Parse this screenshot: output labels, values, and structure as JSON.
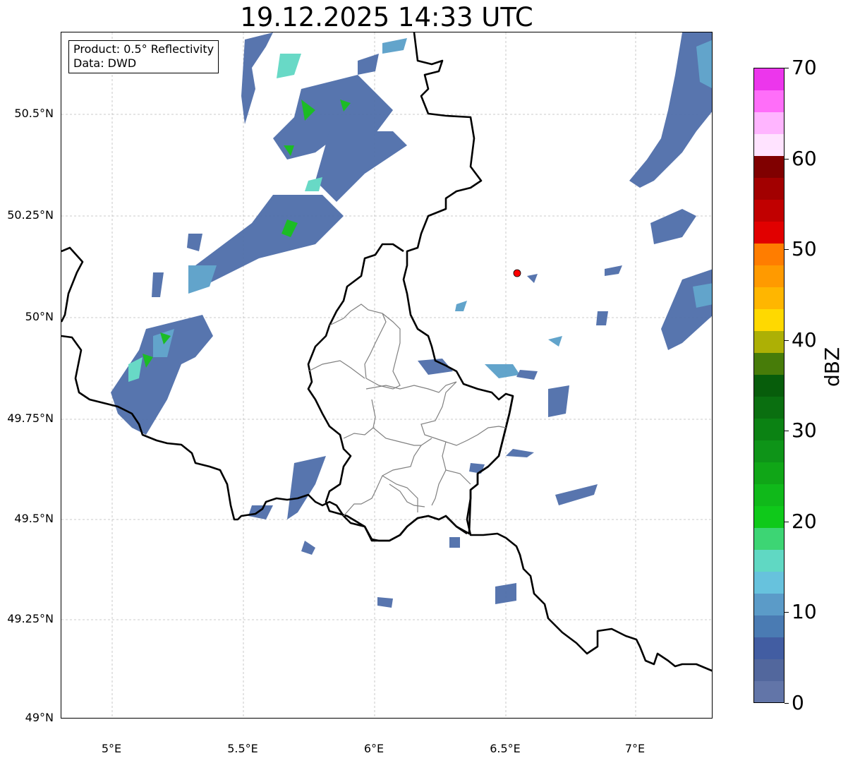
{
  "title": "19.12.2025 14:33 UTC",
  "info": {
    "product": "Product: 0.5° Reflectivity",
    "data": "Data: DWD"
  },
  "lat_ticks": [
    "50.5°N",
    "50.25°N",
    "50°N",
    "49.75°N",
    "49.5°N",
    "49.25°N",
    "49°N"
  ],
  "lon_ticks": [
    "5°E",
    "5.5°E",
    "6°E",
    "6.5°E",
    "7°E"
  ],
  "colorbar": {
    "label": "dBZ",
    "ticks": [
      "0",
      "10",
      "20",
      "30",
      "40",
      "50",
      "60",
      "70"
    ],
    "range": [
      0,
      70
    ],
    "colors": [
      "#6275a8",
      "#52679d",
      "#425da2",
      "#4a7bb3",
      "#5b9bc8",
      "#67c2dd",
      "#60d8c3",
      "#3dd574",
      "#0fc91a",
      "#10b91a",
      "#10a617",
      "#0e9418",
      "#0b8213",
      "#0a6f10",
      "#075d0b",
      "#477c09",
      "#adb005",
      "#ffd900",
      "#ffb600",
      "#ff9a00",
      "#ff7d00",
      "#e10000",
      "#c10000",
      "#a20000",
      "#800000",
      "#ffe3ff",
      "#ffb5ff",
      "#ff6ef9",
      "#ec36ec"
    ]
  },
  "marker": {
    "color": "#ff0000"
  }
}
